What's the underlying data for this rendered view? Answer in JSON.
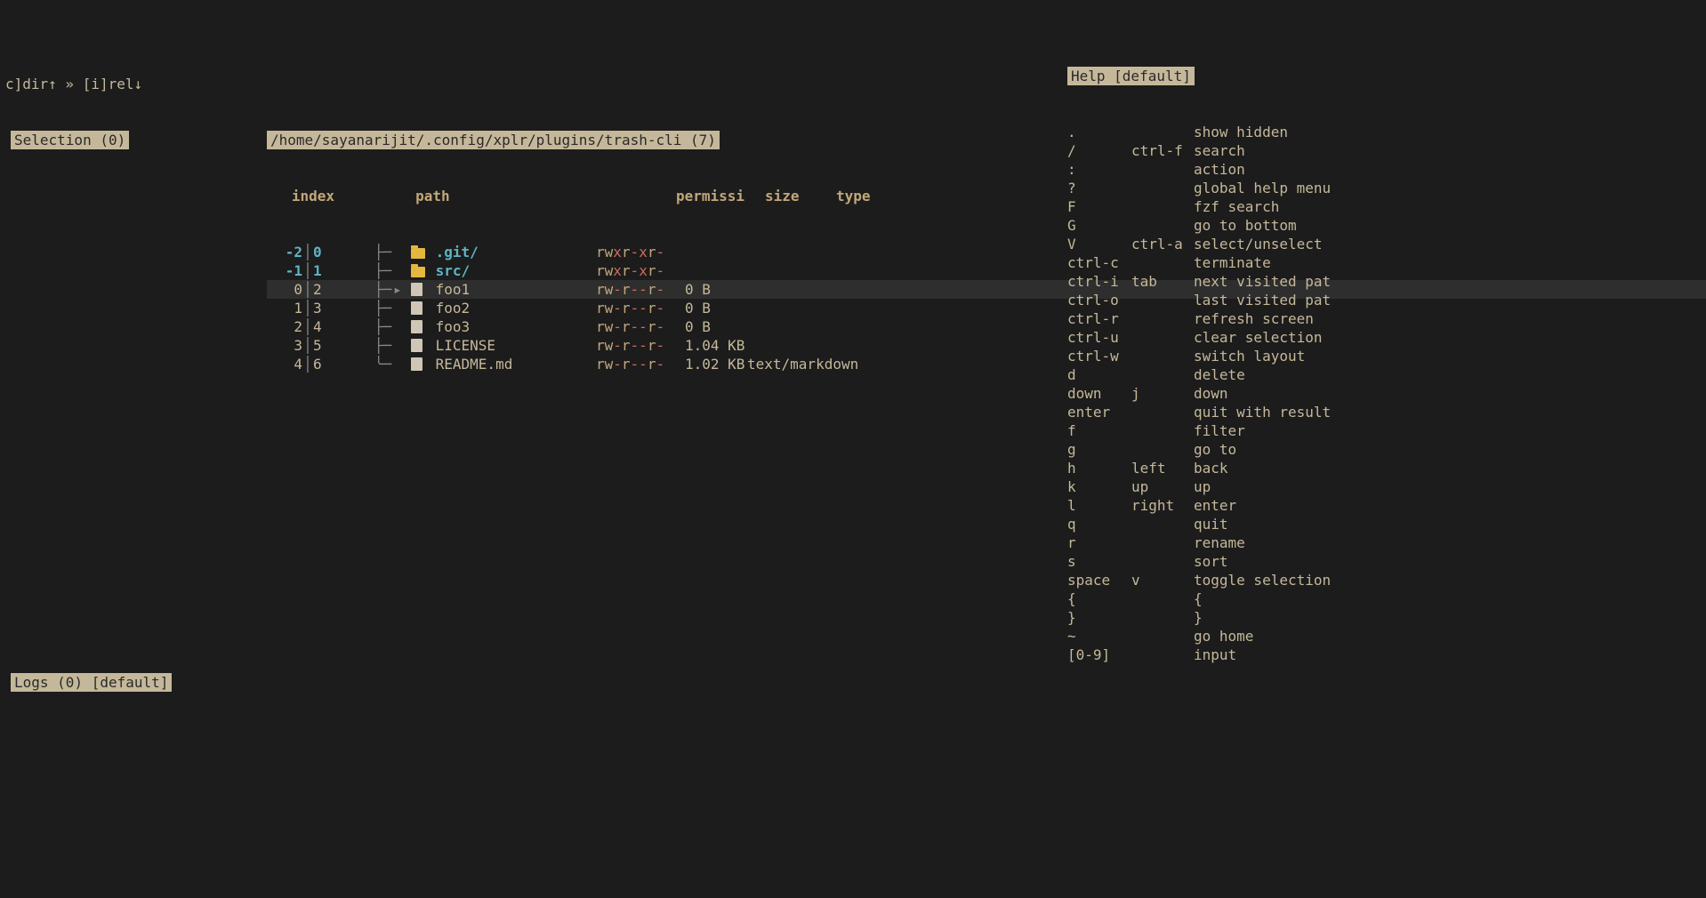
{
  "sortbar": "c]dir↑ » [i]rel↓",
  "selection_badge": "Selection (0)",
  "path_badge": "/home/sayanarijit/.config/xplr/plugins/trash-cli (7)",
  "help_badge": "Help [default]",
  "logs_badge": "Logs (0) [default]",
  "columns": {
    "index": "index",
    "path": "path",
    "perm": "permissi",
    "size": "size",
    "type": "type"
  },
  "rows": [
    {
      "rel": "-2",
      "abs": "0",
      "tree": "├",
      "arrow": "",
      "kind": "dir",
      "name": ".git/",
      "perm_rwx": true,
      "size": "",
      "type": ""
    },
    {
      "rel": "-1",
      "abs": "1",
      "tree": "├",
      "arrow": "",
      "kind": "dir",
      "name": "src/",
      "perm_rwx": true,
      "size": "",
      "type": ""
    },
    {
      "rel": "0",
      "abs": "2",
      "tree": "├",
      "arrow": "▸",
      "kind": "file",
      "name": "foo1",
      "perm_rwx": false,
      "size": "0 B",
      "type": "",
      "cursor": true
    },
    {
      "rel": "1",
      "abs": "3",
      "tree": "├",
      "arrow": "",
      "kind": "file",
      "name": "foo2",
      "perm_rwx": false,
      "size": "0 B",
      "type": ""
    },
    {
      "rel": "2",
      "abs": "4",
      "tree": "├",
      "arrow": "",
      "kind": "file",
      "name": "foo3",
      "perm_rwx": false,
      "size": "0 B",
      "type": ""
    },
    {
      "rel": "3",
      "abs": "5",
      "tree": "├",
      "arrow": "",
      "kind": "file",
      "name": "LICENSE",
      "perm_rwx": false,
      "size": "1.04 KB",
      "type": ""
    },
    {
      "rel": "4",
      "abs": "6",
      "tree": "╰",
      "arrow": "",
      "kind": "file",
      "name": "README.md",
      "perm_rwx": false,
      "size": "1.02 KB",
      "type": "text/markdown"
    }
  ],
  "help": [
    {
      "k1": ".",
      "k2": "",
      "desc": "show hidden"
    },
    {
      "k1": "/",
      "k2": "ctrl-f",
      "desc": "search"
    },
    {
      "k1": ":",
      "k2": "",
      "desc": "action"
    },
    {
      "k1": "?",
      "k2": "",
      "desc": "global help menu"
    },
    {
      "k1": "F",
      "k2": "",
      "desc": "fzf search"
    },
    {
      "k1": "G",
      "k2": "",
      "desc": "go to bottom"
    },
    {
      "k1": "V",
      "k2": "ctrl-a",
      "desc": "select/unselect"
    },
    {
      "k1": "ctrl-c",
      "k2": "",
      "desc": "terminate"
    },
    {
      "k1": "ctrl-i",
      "k2": "tab",
      "desc": "next visited pat"
    },
    {
      "k1": "ctrl-o",
      "k2": "",
      "desc": "last visited pat"
    },
    {
      "k1": "ctrl-r",
      "k2": "",
      "desc": "refresh screen"
    },
    {
      "k1": "ctrl-u",
      "k2": "",
      "desc": "clear selection"
    },
    {
      "k1": "ctrl-w",
      "k2": "",
      "desc": "switch layout"
    },
    {
      "k1": "d",
      "k2": "",
      "desc": "delete"
    },
    {
      "k1": "down",
      "k2": "j",
      "desc": "down"
    },
    {
      "k1": "enter",
      "k2": "",
      "desc": "quit with result"
    },
    {
      "k1": "f",
      "k2": "",
      "desc": "filter"
    },
    {
      "k1": "g",
      "k2": "",
      "desc": "go to"
    },
    {
      "k1": "h",
      "k2": "left",
      "desc": "back"
    },
    {
      "k1": "k",
      "k2": "up",
      "desc": "up"
    },
    {
      "k1": "l",
      "k2": "right",
      "desc": "enter"
    },
    {
      "k1": "q",
      "k2": "",
      "desc": "quit"
    },
    {
      "k1": "r",
      "k2": "",
      "desc": "rename"
    },
    {
      "k1": "s",
      "k2": "",
      "desc": "sort"
    },
    {
      "k1": "space",
      "k2": "v",
      "desc": "toggle selection"
    },
    {
      "k1": "{",
      "k2": "",
      "desc": "{"
    },
    {
      "k1": "}",
      "k2": "",
      "desc": "}"
    },
    {
      "k1": "~",
      "k2": "",
      "desc": "go home"
    },
    {
      "k1": "[0-9]",
      "k2": "",
      "desc": "input"
    }
  ]
}
